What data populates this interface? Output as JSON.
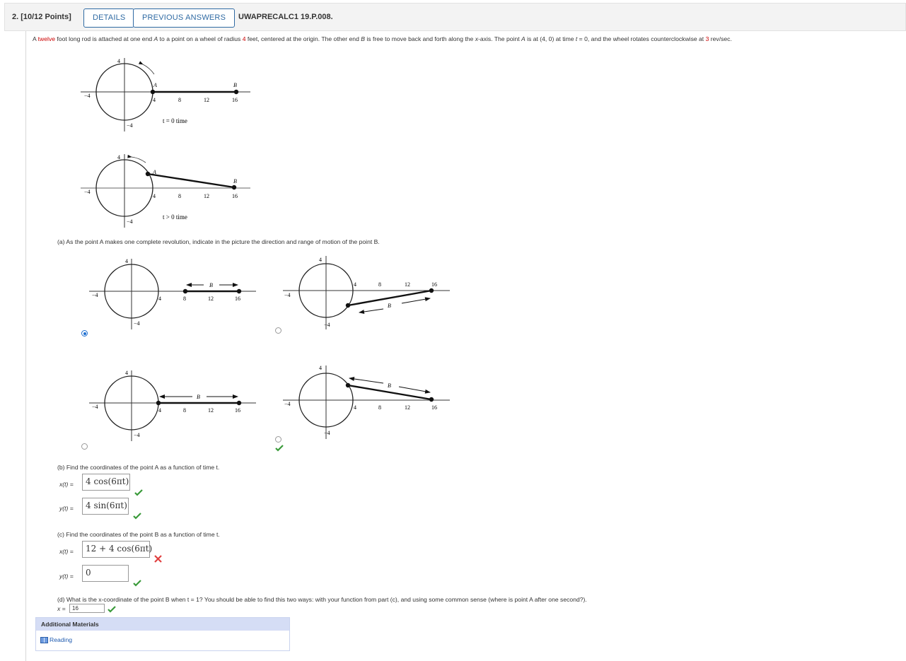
{
  "header": {
    "question_number": "2. [10/12 Points]",
    "details_label": "DETAILS",
    "previous_answers_label": "PREVIOUS ANSWERS",
    "problem_code": "UWAPRECALC1 19.P.008."
  },
  "problem": {
    "p1": "A ",
    "rod_length": "twelve",
    "p2": " foot long rod is attached at one end ",
    "pt_a": "A",
    "p3": " to a point on a wheel of radius ",
    "radius": "4",
    "p4": " feet, centered at the origin. The other end ",
    "pt_b": "B",
    "p5": " is free to move back and forth along the ",
    "x_var": "x",
    "p6": "-axis. The point ",
    "pt_a2": "A",
    "p7": " is at  (4, 0)  at time  ",
    "t_var": "t",
    "p8": " = 0,  and the wheel rotates counterclockwise at ",
    "rate": "3",
    "p9": " rev/sec."
  },
  "figures": {
    "t0_label": "t = 0 time",
    "tpos_label": "t > 0 time",
    "label_A": "A",
    "label_B": "B",
    "tick_4": "4",
    "tick_neg4": "−4",
    "tick_8": "8",
    "tick_12": "12",
    "tick_16": "16"
  },
  "part_a": {
    "prompt": "(a) As the point A makes one complete revolution, indicate in the picture the direction and range of motion of the point B.",
    "options": [
      {
        "id": "opt1",
        "selected": true
      },
      {
        "id": "opt2",
        "selected": false
      },
      {
        "id": "opt3",
        "selected": false
      },
      {
        "id": "opt4",
        "selected": false,
        "marked_correct": true
      }
    ]
  },
  "part_b": {
    "prompt": "(b) Find the coordinates of the point A as a function of time t.",
    "x_label": "x(t) =",
    "x_answer": "4 cos(6πt)",
    "x_status": "correct",
    "y_label": "y(t) =",
    "y_answer": "4 sin(6πt)",
    "y_status": "correct"
  },
  "part_c": {
    "prompt": "(c) Find the coordinates of the point B as a function of time t.",
    "x_label": "x(t) =",
    "x_answer": "12 + 4 cos(6πt)",
    "x_status": "incorrect",
    "y_label": "y(t) =",
    "y_answer": "0",
    "y_status": "correct"
  },
  "part_d": {
    "prompt": "(d) What is the x-coordinate of the point B when  t = 1?  You should be able to find this two ways: with your function from part (c), and using some common sense (where is point A after one second?).",
    "x_label": "x =",
    "answer": "16",
    "status": "correct"
  },
  "additional": {
    "title": "Additional Materials",
    "link": "Reading"
  },
  "colors": {
    "link_blue": "#2f6aa3",
    "correct_green": "#3a9a3a",
    "incorrect_red": "#e04040",
    "highlight_red": "#cc0000"
  }
}
